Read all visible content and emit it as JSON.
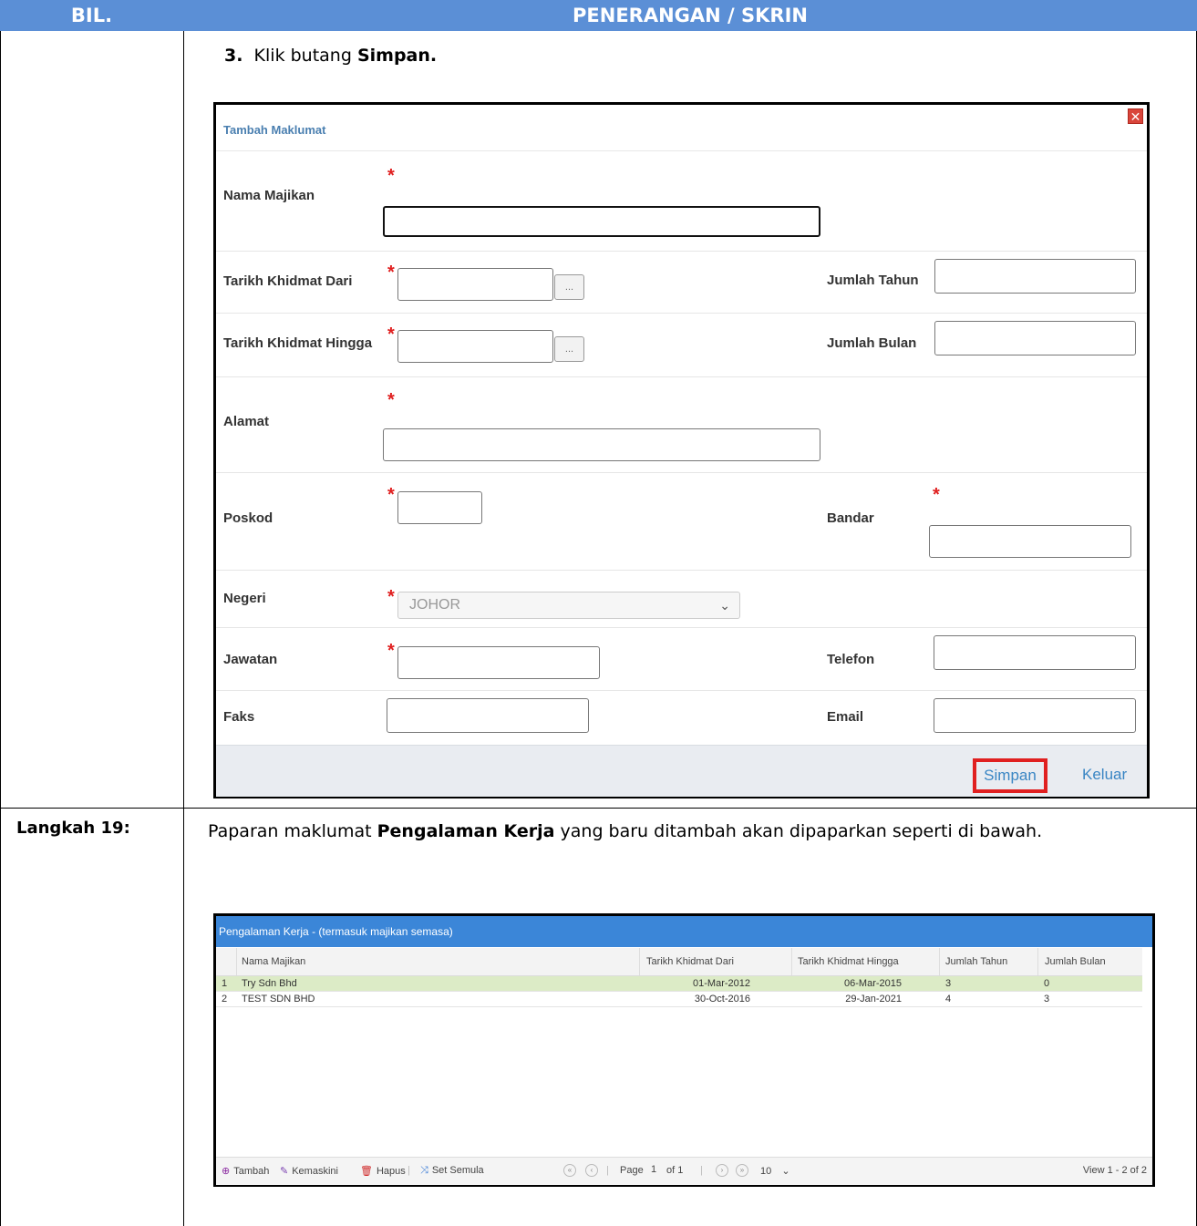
{
  "header": {
    "bil": "BIL.",
    "desc": "PENERANGAN / SKRIN"
  },
  "step3": {
    "num": "3.",
    "pre": "Klik butang",
    "bold": "Simpan."
  },
  "dialog": {
    "title": "Tambah Maklumat",
    "close": "✕",
    "labels": {
      "nama_majikan": "Nama Majikan",
      "tarikh_dari": "Tarikh Khidmat Dari",
      "tarikh_hingga": "Tarikh Khidmat Hingga",
      "jumlah_tahun": "Jumlah Tahun",
      "jumlah_bulan": "Jumlah Bulan",
      "alamat": "Alamat",
      "poskod": "Poskod",
      "bandar": "Bandar",
      "negeri": "Negeri",
      "jawatan": "Jawatan",
      "telefon": "Telefon",
      "faks": "Faks",
      "email": "Email"
    },
    "required_mark": "*",
    "date_button": "...",
    "negeri_value": "JOHOR",
    "buttons": {
      "simpan": "Simpan",
      "keluar": "Keluar"
    }
  },
  "step19": {
    "label": "Langkah 19:",
    "pre": "Paparan maklumat",
    "bold": "Pengalaman Kerja",
    "post": "yang baru ditambah akan dipaparkan seperti di bawah."
  },
  "grid": {
    "caption": "Pengalaman Kerja - (termasuk majikan semasa)",
    "columns": [
      "Nama Majikan",
      "Tarikh Khidmat Dari",
      "Tarikh Khidmat Hingga",
      "Jumlah Tahun",
      "Jumlah Bulan"
    ],
    "rows": [
      {
        "no": "1",
        "nama": "Try Sdn Bhd",
        "dari": "01-Mar-2012",
        "hingga": "06-Mar-2015",
        "tahun": "3",
        "bulan": "0"
      },
      {
        "no": "2",
        "nama": "TEST SDN BHD",
        "dari": "30-Oct-2016",
        "hingga": "29-Jan-2021",
        "tahun": "4",
        "bulan": "3"
      }
    ],
    "footer": {
      "tambah": "Tambah",
      "kemaskini": "Kemaskini",
      "hapus": "Hapus",
      "set_semula": "Set Semula",
      "page_label": "Page",
      "page_value": "1",
      "of_label": "of 1",
      "rows_per_page": "10",
      "view": "View 1 - 2 of 2"
    }
  }
}
